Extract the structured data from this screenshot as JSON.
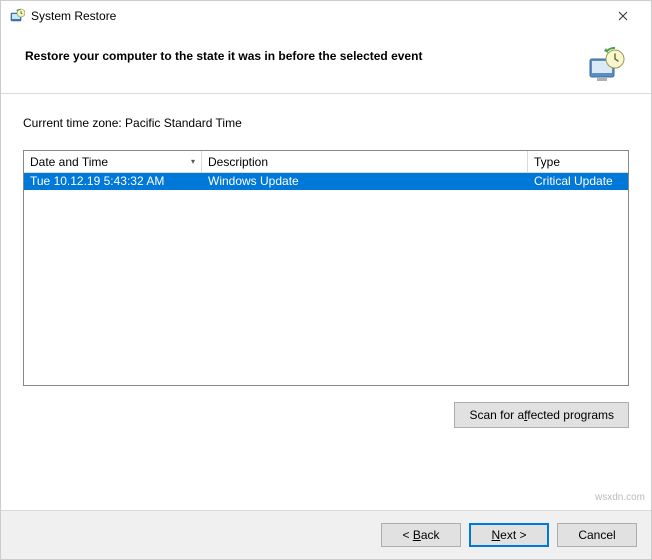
{
  "titlebar": {
    "title": "System Restore"
  },
  "header": {
    "text": "Restore your computer to the state it was in before the selected event"
  },
  "content": {
    "timezone_prefix": "Current time zone: ",
    "timezone_value": "Pacific Standard Time"
  },
  "table": {
    "columns": {
      "date": "Date and Time",
      "desc": "Description",
      "type": "Type"
    },
    "rows": [
      {
        "date": "Tue 10.12.19 5:43:32 AM",
        "desc": "Windows Update",
        "type": "Critical Update",
        "selected": true
      }
    ]
  },
  "scan": {
    "label_pre": "Scan for a",
    "label_accel": "f",
    "label_post": "fected programs"
  },
  "footer": {
    "back_pre": "< ",
    "back_accel": "B",
    "back_post": "ack",
    "next_accel": "N",
    "next_post": "ext >",
    "cancel": "Cancel"
  },
  "watermark": "wsxdn.com"
}
